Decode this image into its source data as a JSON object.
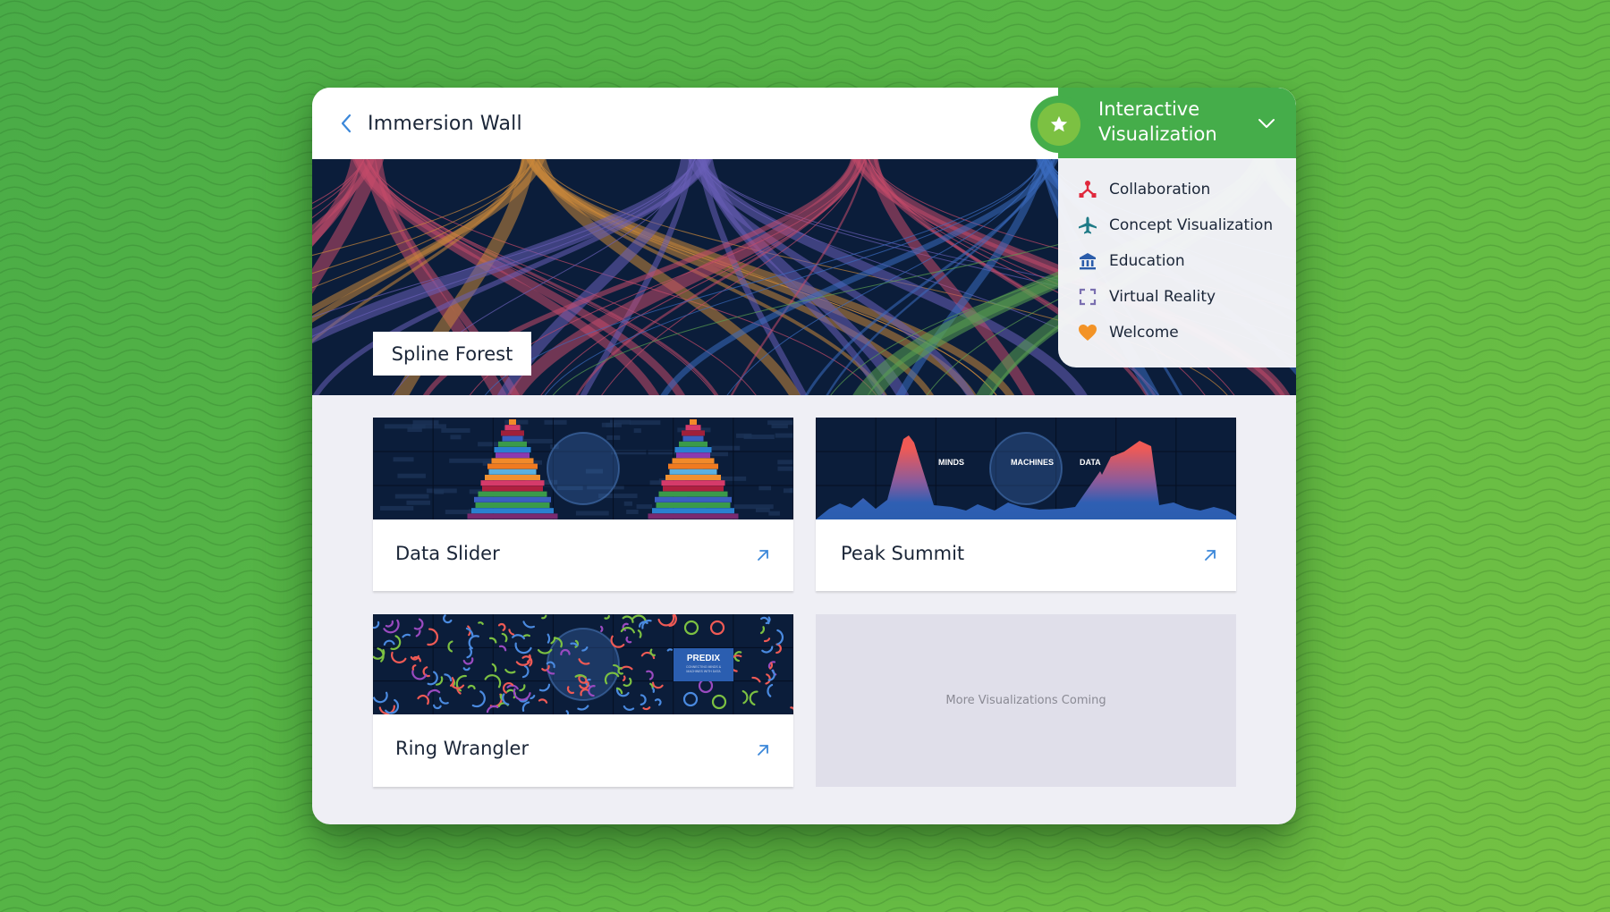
{
  "header": {
    "back_icon": "chevron-left-icon",
    "title": "Immersion Wall"
  },
  "banner": {
    "label": "Spline Forest"
  },
  "category_dropdown": {
    "icon": "star-icon",
    "selected_line1": "Interactive",
    "selected_line2": "Visualization",
    "chevron_icon": "chevron-down-icon",
    "options": [
      {
        "label": "Collaboration",
        "icon": "network-icon",
        "color": "#e0283c"
      },
      {
        "label": "Concept Visualization",
        "icon": "airplane-icon",
        "color": "#1e7a86"
      },
      {
        "label": "Education",
        "icon": "institution-icon",
        "color": "#2a5caa"
      },
      {
        "label": "Virtual Reality",
        "icon": "expand-frame-icon",
        "color": "#7a6fb0"
      },
      {
        "label": "Welcome",
        "icon": "heart-icon",
        "color": "#f39326"
      }
    ]
  },
  "tiles": [
    {
      "name": "Data Slider",
      "link_icon": "arrow-up-right-icon"
    },
    {
      "name": "Peak Summit",
      "link_icon": "arrow-up-right-icon",
      "thumb_labels": [
        "MINDS",
        "MACHINES",
        "DATA"
      ]
    },
    {
      "name": "Ring Wrangler",
      "link_icon": "arrow-up-right-icon",
      "thumb_badge_title": "PREDIX",
      "thumb_badge_sub": "CONNECTING MINDS & MACHINES WITH DATA"
    }
  ],
  "placeholder": {
    "text": "More Visualizations Coming"
  },
  "colors": {
    "accent_green": "#45ad4a",
    "accent_light_green": "#7cc142",
    "navy": "#0b1d3a",
    "link_blue": "#3b87d9",
    "text_dark": "#1b2638",
    "panel_bg": "#efeff5"
  }
}
